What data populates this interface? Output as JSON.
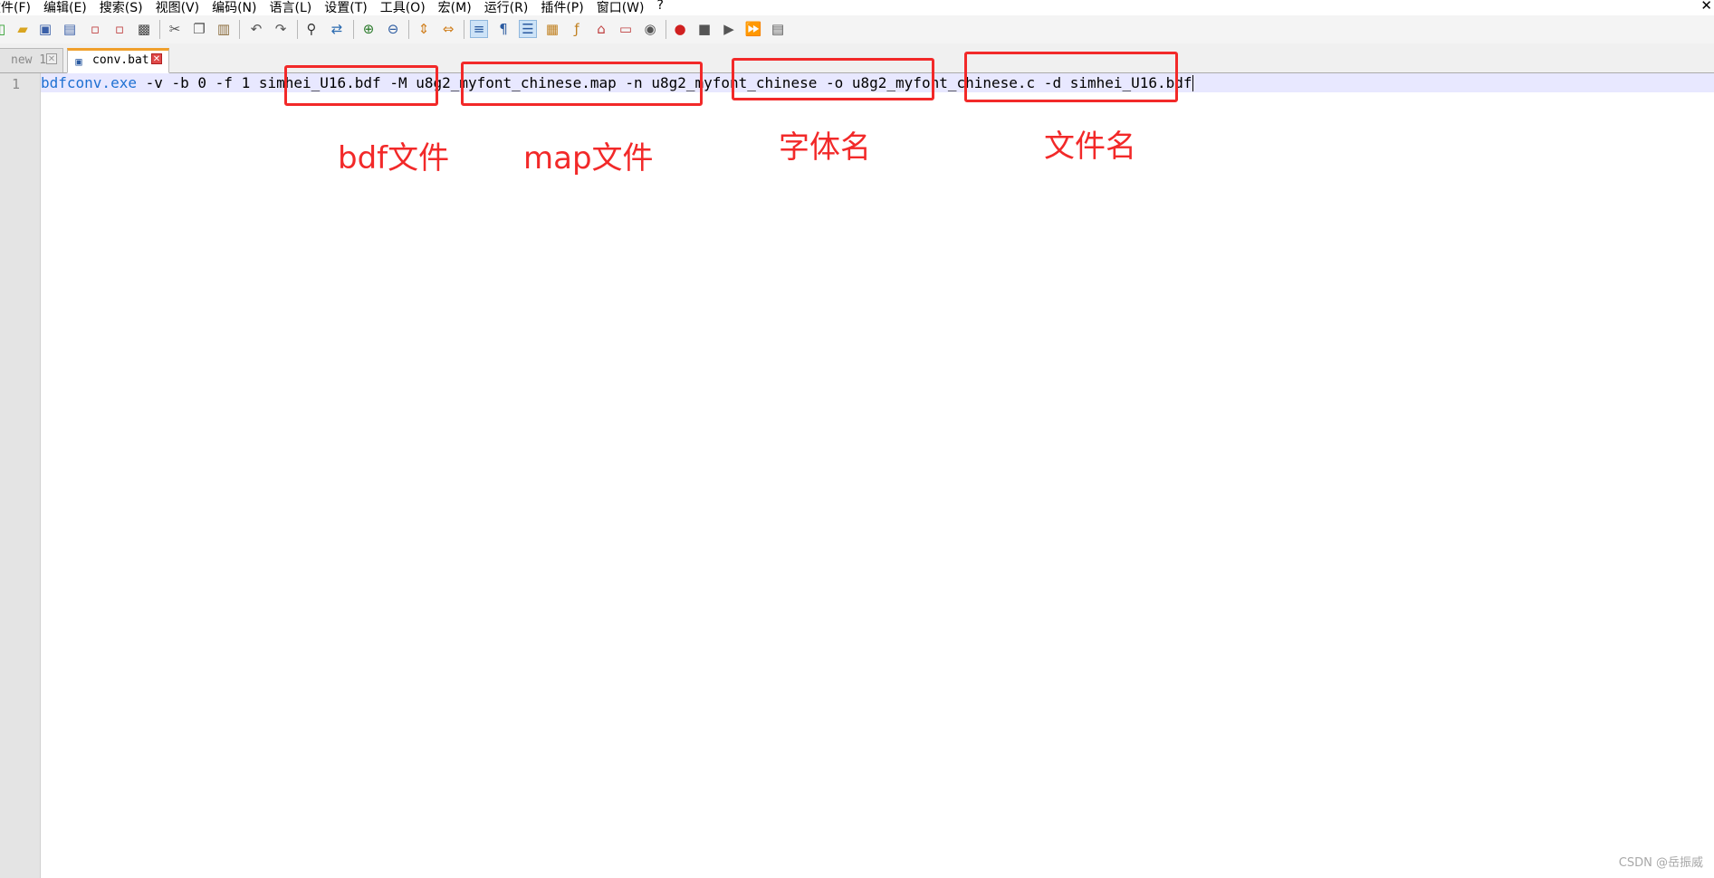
{
  "menubar": {
    "items": [
      "文件(F)",
      "编辑(E)",
      "搜索(S)",
      "视图(V)",
      "编码(N)",
      "语言(L)",
      "设置(T)",
      "工具(O)",
      "宏(M)",
      "运行(R)",
      "插件(P)",
      "窗口(W)",
      "?"
    ],
    "close_symbol": "✕"
  },
  "tabs": [
    {
      "label": "new 1",
      "active": false
    },
    {
      "label": "conv.bat",
      "active": true
    }
  ],
  "editor": {
    "line_number": "1",
    "tokens": {
      "exe": "bdfconv.exe",
      "flags1": " -v -b 0 -f 1 ",
      "bdf_file": "simhei_U16.bdf",
      "flag_M": " -M ",
      "map_file": "u8g2_myfont_chinese.map",
      "flag_n": " -n ",
      "font_name": "u8g2_myfont_chinese",
      "flag_o": " -o ",
      "output_file": "u8g2_myfont_chinese.c",
      "flag_d": " -d ",
      "display_file": "simhei_U16.bdf"
    }
  },
  "annotations": {
    "bdf_label": "bdf文件",
    "map_label": "map文件",
    "font_label": "字体名",
    "file_label": "文件名",
    "color": "#f22929"
  },
  "watermark": "CSDN @岳振威"
}
